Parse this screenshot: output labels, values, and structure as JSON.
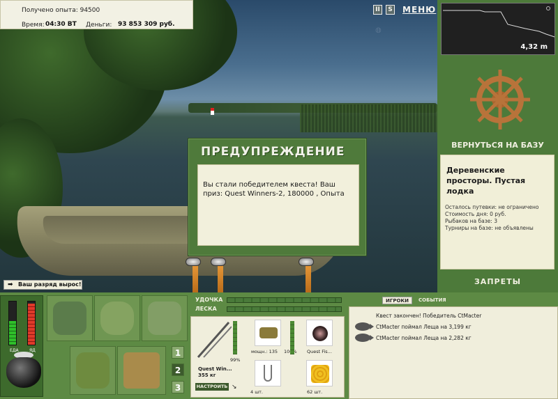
{
  "info": {
    "exp_label": "Получено опыта: 94500",
    "time_label": "Время:",
    "time_value": "04:30 ВТ",
    "money_label": "Деньги:",
    "money_value": "93 853 309 руб."
  },
  "controls": {
    "pause": "II",
    "sound": "S",
    "menu": "МЕНЮ"
  },
  "depth": {
    "value": "4,32 m"
  },
  "right": {
    "return_to_base": "ВЕРНУТЬСЯ НА БАЗУ",
    "lake_name": "Деревенские просторы. Пустая лодка",
    "stats": [
      "Осталось путевки: не ограничено",
      "Стоимость дня: 0 руб.",
      "Рыбаков на базе: 3",
      "Турниры на базе: не объявлены"
    ],
    "bans": "ЗАПРЕТЫ"
  },
  "rank": {
    "text": "Ваш разряд вырос!"
  },
  "dialog": {
    "title": "ПРЕДУПРЕЖДЕНИЕ",
    "message": "Вы стали победителем квеста! Ваш приз: Quest Winners-2, 180000 , Опыта"
  },
  "gauges": {
    "food_label": "ЕДА",
    "fatigue_label": "ЯД",
    "food_level": 0.55,
    "fatigue_level": 0.95,
    "food_color": "#2fc02a",
    "fatigue_color": "#e03a2a"
  },
  "pages": [
    "1",
    "2",
    "3"
  ],
  "tackle": {
    "rod_label": "УДОЧКА",
    "line_label": "ЛЕСКА",
    "rod_name": "Quest Win...",
    "rod_weight": "355 кг",
    "rod_percent": "99%",
    "reel_name": "мощн.: 135",
    "reel_percent": "100%",
    "line_name": "Quest Fis...",
    "hook_count": "4 шт.",
    "bait_count": "62 шт.",
    "setup_button": "НАСТРОИТЬ"
  },
  "events": {
    "tab_players": "ИГРОКИ",
    "tab_events": "СОБЫТИЯ",
    "lines": [
      "Квест закончен! Победитель CtMacter",
      "CtMacter поймал Леща на 3,199 кг",
      "CtMacter поймал Леща на 2,282 кг"
    ]
  },
  "colors": {
    "panel_green": "#4d7a3a",
    "bar_green": "#5d8a44",
    "paper": "#f0eedc"
  }
}
